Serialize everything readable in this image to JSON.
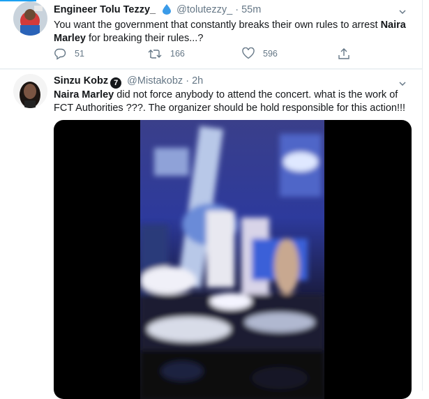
{
  "tweets": [
    {
      "name": "Engineer Tolu Tezzy_",
      "handle": "@tolutezzy_",
      "separator": "·",
      "time": "55m",
      "text_parts": [
        {
          "t": "You want the government that constantly breaks their own rules to arrest ",
          "bold": false
        },
        {
          "t": "Naira Marley",
          "bold": true
        },
        {
          "t": " for breaking their rules...?",
          "bold": false
        }
      ],
      "reply_count": "51",
      "retweet_count": "166",
      "like_count": "596"
    },
    {
      "name": "Sinzu Kobz",
      "badge": "7",
      "handle": "@Mistakobz",
      "separator": "·",
      "time": "2h",
      "text_parts": [
        {
          "t": "Naira Marley",
          "bold": true
        },
        {
          "t": " did not force anybody to attend the concert. what is the work of FCT Authorities ???. The organizer should be hold responsible for this action!!!",
          "bold": false
        }
      ]
    }
  ],
  "colors": {
    "text": "#14171a",
    "secondary": "#657786",
    "border": "#e6ecf0",
    "accent": "#1da1f2"
  },
  "icons": {
    "reply": "speech-bubble-icon",
    "retweet": "retweet-icon",
    "like": "heart-icon",
    "share": "share-icon",
    "caret": "chevron-down-icon"
  }
}
